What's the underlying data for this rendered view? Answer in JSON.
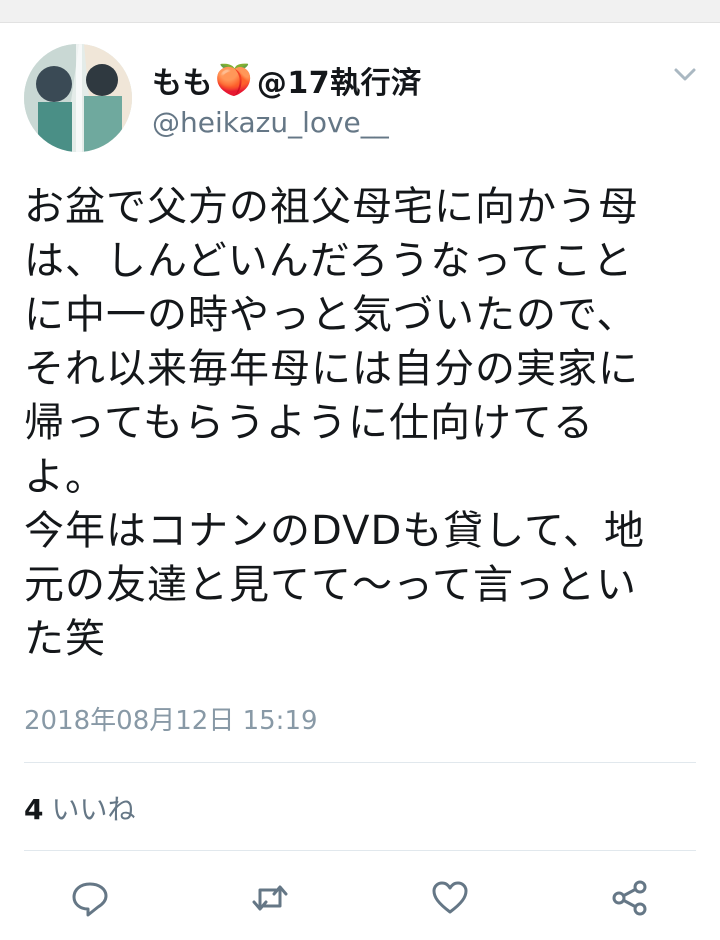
{
  "user": {
    "display_name": "もも",
    "emoji": "🍑",
    "suffix": "@17執行済",
    "handle": "@heikazu_love__"
  },
  "tweet": {
    "text": "お盆で父方の祖父母宅に向かう母\nは、しんどいんだろうなってこと\nに中一の時やっと気づいたので、\nそれ以来毎年母には自分の実家に\n帰ってもらうように仕向けてる\nよ。\n今年はコナンのDVDも貸して、地\n元の友達と見てて〜って言っとい\nた笑",
    "timestamp": "2018年08月12日 15:19"
  },
  "stats": {
    "likes_count": "4",
    "likes_label": "いいね"
  },
  "icons": {
    "menu": "chevron-down-icon",
    "reply": "reply-icon",
    "retweet": "retweet-icon",
    "like": "heart-icon",
    "share": "share-icon"
  },
  "colors": {
    "text": "#14171a",
    "secondary": "#657786",
    "icon": "#657786",
    "divider": "#e1e8ed"
  }
}
